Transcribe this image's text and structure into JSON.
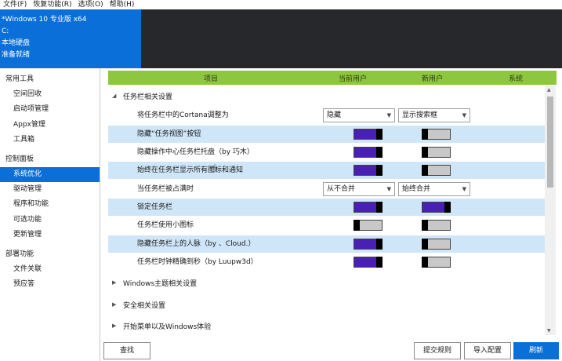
{
  "menu": [
    "文件(F)",
    "恢复功能(R)",
    "选项(O)",
    "帮助(H)"
  ],
  "header": {
    "os": "*Windows 10 专业版 x64",
    "drive": "C:",
    "disk_type": "本地硬盘",
    "status": "准备就绪"
  },
  "sidebar": {
    "groups": [
      {
        "label": "常用工具",
        "items": [
          "空间回收",
          "启动项管理",
          "Appx管理",
          "工具箱"
        ]
      },
      {
        "label": "控制面板",
        "items": [
          "系统优化",
          "驱动管理",
          "程序和功能",
          "可选功能",
          "更新管理"
        ]
      },
      {
        "label": "部署功能",
        "items": [
          "文件关联",
          "预应答"
        ]
      }
    ],
    "active": "系统优化"
  },
  "table": {
    "headers": [
      "项目",
      "当前用户",
      "新用户",
      "系统"
    ],
    "section_expanded": "任务栏相关设置",
    "rows": [
      {
        "label": "将任务栏中的Cortana调整为",
        "type": "select",
        "current": "隐藏",
        "new": "显示搜索框"
      },
      {
        "label": "隐藏“任务视图”按钮",
        "type": "toggle",
        "current": true,
        "new": false
      },
      {
        "label": "隐藏操作中心任务栏托盘（by 巧木）",
        "type": "toggle",
        "current": true,
        "new": false
      },
      {
        "label": "始终在任务栏显示所有图标和通知",
        "type": "toggle",
        "current": true,
        "new": false
      },
      {
        "label": "当任务栏被占满时",
        "type": "select",
        "current": "从不合并",
        "new": "始终合并"
      },
      {
        "label": "锁定任务栏",
        "type": "toggle",
        "current": true,
        "new": true
      },
      {
        "label": "任务栏使用小图标",
        "type": "toggle",
        "current": false,
        "new": false
      },
      {
        "label": "隐藏任务栏上的人脉（by 、Cloud.）",
        "type": "toggle",
        "current": true,
        "new": false
      },
      {
        "label": "任务栏时钟精确到秒（by Luupw3d）",
        "type": "toggle",
        "current": true,
        "new": false
      }
    ],
    "collapsed_sections": [
      "Windows主题相关设置",
      "安全相关设置",
      "开始菜单以及Windows体验"
    ]
  },
  "buttons": {
    "find": "查找",
    "submit_rule": "提交规则",
    "import_config": "导入配置",
    "refresh": "刷新"
  },
  "colors": {
    "accent": "#0a6fd8",
    "header_green": "#8dc63f",
    "toggle_on": "#4a1fb5",
    "row_alt": "#cfe6f8"
  }
}
